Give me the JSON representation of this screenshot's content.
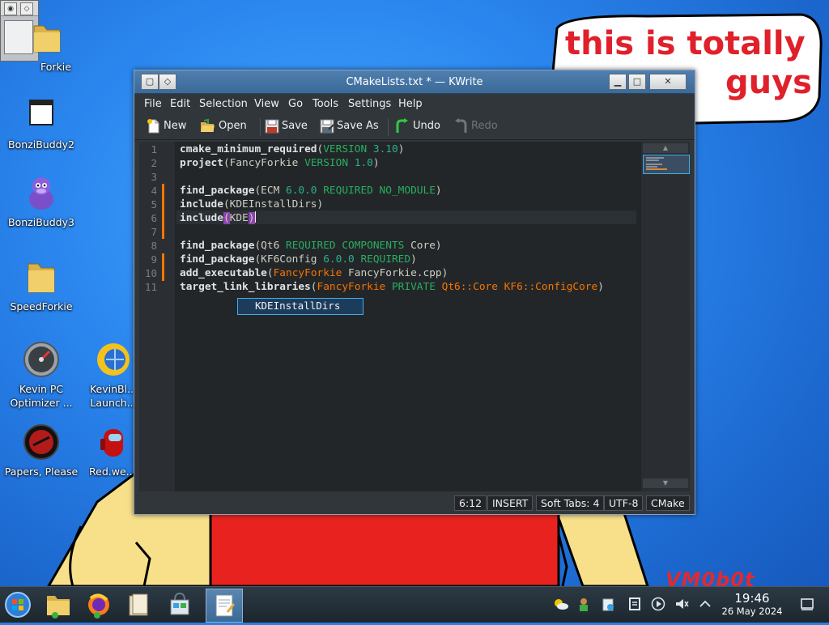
{
  "desktop": {
    "speech_line1": "this is totally",
    "speech_line2": "guys",
    "watermark": "VM0b0t",
    "icons": [
      {
        "label": "Forkie",
        "icon": "folder-icon"
      },
      {
        "label": "BonziBuddy2",
        "icon": "app-window-icon"
      },
      {
        "label": "BonziBuddy3",
        "icon": "purple-gorilla-icon"
      },
      {
        "label": "SpeedForkie",
        "icon": "folder-icon"
      },
      {
        "label": "Kevin PC Optimizer ...",
        "icon": "speedometer-icon"
      },
      {
        "label": "KevinBl... Launch...",
        "icon": "globe-sun-icon"
      },
      {
        "label": "Papers, Please",
        "icon": "red-seal-icon"
      },
      {
        "label": "Red.we...",
        "icon": "red-crewmate-icon"
      }
    ]
  },
  "window": {
    "title": "CMakeLists.txt * — KWrite",
    "menu": [
      "File",
      "Edit",
      "Selection",
      "View",
      "Go",
      "Tools",
      "Settings",
      "Help"
    ],
    "toolbar": {
      "new": "New",
      "open": "Open",
      "save": "Save",
      "save_as": "Save As",
      "undo": "Undo",
      "redo": "Redo"
    },
    "line_numbers": [
      "1",
      "2",
      "3",
      "4",
      "5",
      "6",
      "7",
      "8",
      "9",
      "10",
      "11"
    ],
    "code": {
      "l1_kw": "cmake_minimum_required",
      "l1_a": "(",
      "l1_b": "VERSION",
      "l1_c": " 3.10",
      "l1_d": ")",
      "l2_kw": "project",
      "l2_a": "(FancyForkie ",
      "l2_b": "VERSION",
      "l2_c": " 1.0",
      "l2_d": ")",
      "l4_kw": "find_package",
      "l4_a": "(ECM ",
      "l4_b": "6.0.0",
      "l4_c": " REQUIRED NO_MODULE",
      "l4_d": ")",
      "l5_kw": "include",
      "l5_a": "(KDEInstallDirs)",
      "l6_kw": "include",
      "l6_a": "(",
      "l6_b": "KDE",
      "l6_c": ")",
      "l8_kw": "find_package",
      "l8_a": "(Qt6 ",
      "l8_b": "REQUIRED COMPONENTS",
      "l8_c": " Core)",
      "l9_kw": "find_package",
      "l9_a": "(KF6Config ",
      "l9_b": "6.0.0",
      "l9_c": " REQUIRED",
      "l9_d": ")",
      "l10_kw": "add_executable",
      "l10_a": "(",
      "l10_b": "FancyForkie",
      "l10_c": " FancyForkie.cpp)",
      "l11_kw": "target_link_libraries",
      "l11_a": "(",
      "l11_b": "FancyForkie",
      "l11_c": " PRIVATE",
      "l11_d": " Qt6::Core KF6::ConfigCore",
      "l11_e": ")"
    },
    "completion": "KDEInstallDirs",
    "status": {
      "position": "6:12",
      "mode": "INSERT",
      "tabs": "Soft Tabs: 4",
      "encoding": "UTF-8",
      "syntax": "CMake"
    }
  },
  "taskbar": {
    "time": "19:46",
    "date": "26 May 2024"
  },
  "colors": {
    "accent": "#3daee9",
    "modified_marker": "#f67400",
    "bracket_highlight": "#8e44ad"
  }
}
